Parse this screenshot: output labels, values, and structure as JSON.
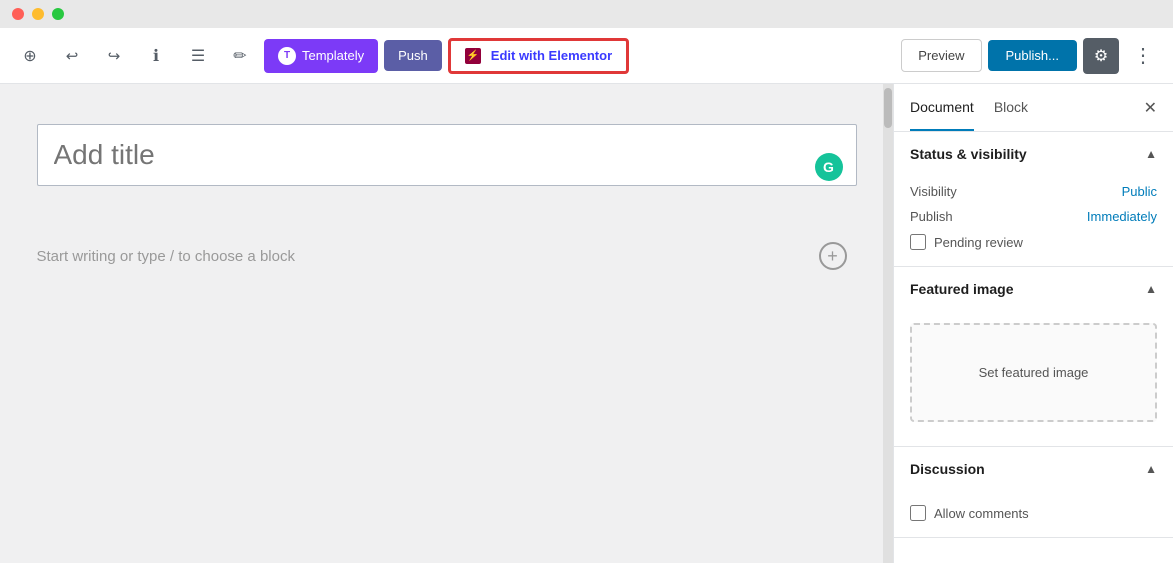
{
  "titleBar": {
    "lights": [
      "red",
      "yellow",
      "green"
    ]
  },
  "toolbar": {
    "add_label": "+",
    "undo_label": "↩",
    "redo_label": "↪",
    "info_label": "ℹ",
    "list_label": "☰",
    "pen_label": "✏",
    "templately_label": "Templately",
    "push_label": "Push",
    "elementor_label": "Edit with Elementor",
    "preview_label": "Preview",
    "publish_label": "Publish...",
    "settings_label": "⚙",
    "more_label": "⋮"
  },
  "editor": {
    "title_placeholder": "Add title",
    "block_hint": "Start writing or type / to choose a block",
    "grammarly_letter": "G"
  },
  "sidebar": {
    "tabs": [
      {
        "label": "Document",
        "active": true
      },
      {
        "label": "Block",
        "active": false
      }
    ],
    "close_label": "✕",
    "sections": [
      {
        "id": "status-visibility",
        "title": "Status & visibility",
        "expanded": true,
        "rows": [
          {
            "label": "Visibility",
            "value": "Public"
          },
          {
            "label": "Publish",
            "value": "Immediately"
          }
        ],
        "checkbox": {
          "label": "Pending review",
          "checked": false
        }
      },
      {
        "id": "featured-image",
        "title": "Featured image",
        "expanded": true,
        "set_image_label": "Set featured image"
      },
      {
        "id": "discussion",
        "title": "Discussion",
        "expanded": true,
        "checkbox": {
          "label": "Allow comments",
          "checked": false
        }
      }
    ]
  }
}
